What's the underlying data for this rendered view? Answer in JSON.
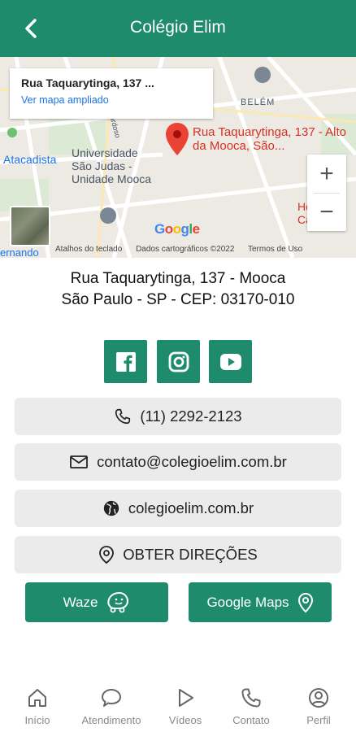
{
  "header": {
    "title": "Colégio Elim",
    "back_icon": "arrow-left-icon"
  },
  "map": {
    "card_address": "Rua Taquarytinga, 137 ...",
    "card_link": "Ver mapa ampliado",
    "pin_label": "Rua Taquarytinga, 137 - Alto da Mooca, São...",
    "zoom_in": "+",
    "zoom_out": "−",
    "google_logo": "Google",
    "footer": [
      "Atalhos do teclado",
      "Dados cartográficos ©2022",
      "Termos de Uso"
    ],
    "labels": {
      "belem": "BELÉM",
      "atacadista": "Atacadista",
      "universidade": "Universidade São Judas - Unidade Mooca",
      "hospital": "Hos Cân",
      "fernando": "ernando",
      "cardoso": "ardoso"
    }
  },
  "address": {
    "line1": "Rua Taquarytinga, 137 - Mooca",
    "line2": "São Paulo - SP - CEP: 03170-010"
  },
  "social": [
    "facebook-icon",
    "instagram-icon",
    "youtube-icon"
  ],
  "contacts": {
    "phone": "(11) 2292-2123",
    "email": "contato@colegioelim.com.br",
    "website": "colegioelim.com.br",
    "directions": "OBTER DIREÇÕES"
  },
  "nav_buttons": {
    "waze": "Waze",
    "google_maps": "Google Maps"
  },
  "bottom_nav": [
    {
      "label": "Início",
      "icon": "home-icon"
    },
    {
      "label": "Atendimento",
      "icon": "chat-bubble-icon"
    },
    {
      "label": "Vídeos",
      "icon": "play-icon"
    },
    {
      "label": "Contato",
      "icon": "phone-icon"
    },
    {
      "label": "Perfil",
      "icon": "user-icon"
    }
  ],
  "colors": {
    "brand": "#1e8c6c",
    "pin": "#d93025",
    "link": "#1a73e8"
  }
}
